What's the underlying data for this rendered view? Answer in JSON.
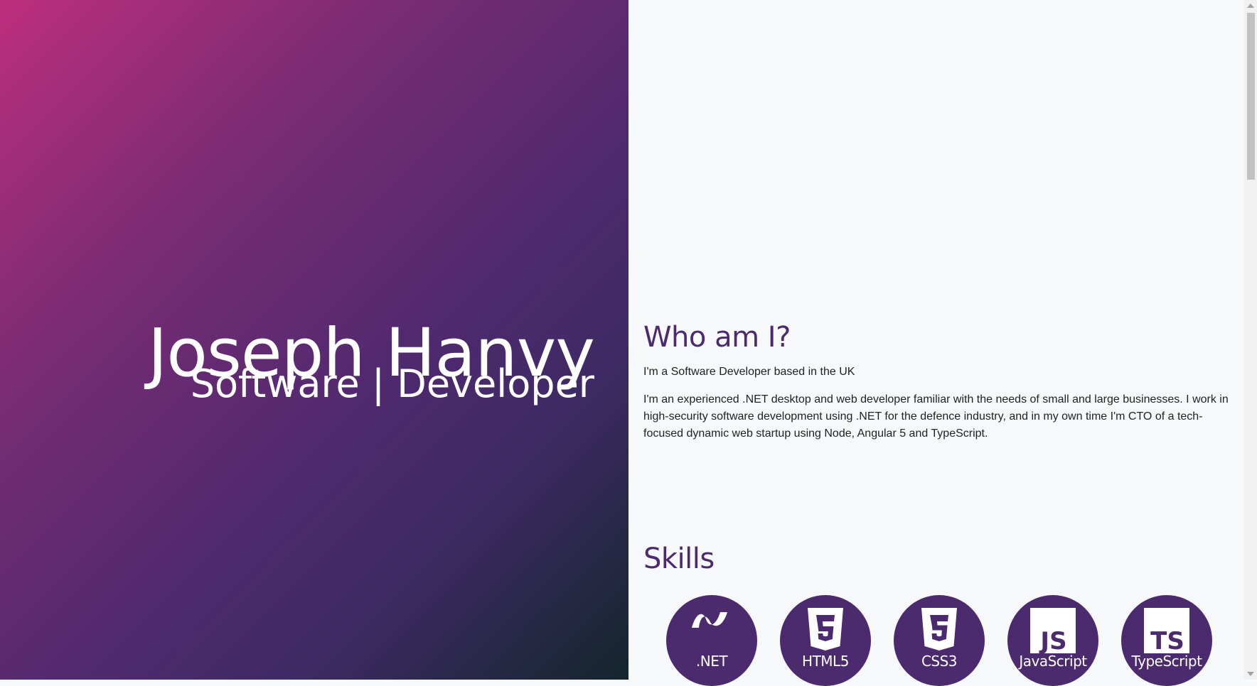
{
  "hero": {
    "name": "Joseph Hanvy",
    "subtitle": "Software | Developer"
  },
  "about": {
    "heading": "Who am I?",
    "intro": "I'm a Software Developer based in the UK",
    "body": "I'm an experienced .NET desktop and web developer familiar with the needs of small and large businesses. I work in high-security software development using .NET for the defence industry, and in my own time I'm CTO of a tech-focused dynamic web startup using Node, Angular 5 and TypeScript."
  },
  "skills": {
    "heading": "Skills",
    "items": [
      {
        "label": ".NET",
        "icon": "dotnet-icon"
      },
      {
        "label": "HTML5",
        "icon": "html5-icon"
      },
      {
        "label": "CSS3",
        "icon": "css3-icon"
      },
      {
        "label": "JavaScript",
        "icon": "javascript-icon"
      },
      {
        "label": "TypeScript",
        "icon": "typescript-icon"
      }
    ]
  },
  "colors": {
    "accent": "#4b2a6e",
    "gradient_start": "#bd2e7c",
    "gradient_end": "#14262d",
    "content_bg": "#f7f8fa"
  }
}
